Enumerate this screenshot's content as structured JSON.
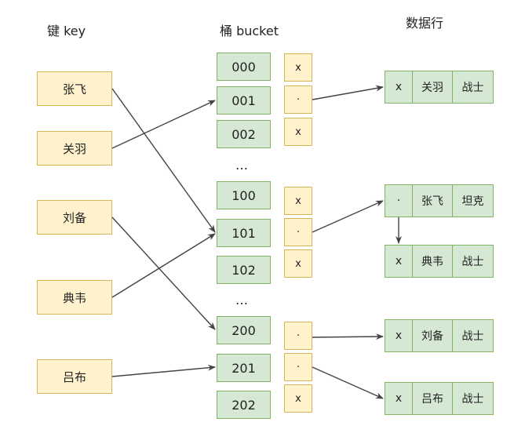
{
  "headers": {
    "key": "键 key",
    "bucket": "桶 bucket",
    "row": "数据行"
  },
  "keys": [
    "张飞",
    "关羽",
    "刘备",
    "典韦",
    "吕布"
  ],
  "buckets": {
    "group1": [
      "000",
      "001",
      "002"
    ],
    "group2": [
      "100",
      "101",
      "102"
    ],
    "group3": [
      "200",
      "201",
      "202"
    ],
    "ellipsis": "…"
  },
  "slots": {
    "group1": [
      "x",
      "·",
      "x"
    ],
    "group2": [
      "x",
      "·",
      "x"
    ],
    "group3": [
      "·",
      "·",
      "x"
    ]
  },
  "rows": [
    {
      "ptr": "x",
      "name": "关羽",
      "role": "战士"
    },
    {
      "ptr": "·",
      "name": "张飞",
      "role": "坦克"
    },
    {
      "ptr": "x",
      "name": "典韦",
      "role": "战士"
    },
    {
      "ptr": "x",
      "name": "刘备",
      "role": "战士"
    },
    {
      "ptr": "x",
      "name": "吕布",
      "role": "战士"
    }
  ],
  "colors": {
    "key_fill": "#fff2cc",
    "key_stroke": "#d6b656",
    "bucket_fill": "#d5e8d4",
    "bucket_stroke": "#82b366",
    "arrow": "#444444"
  }
}
